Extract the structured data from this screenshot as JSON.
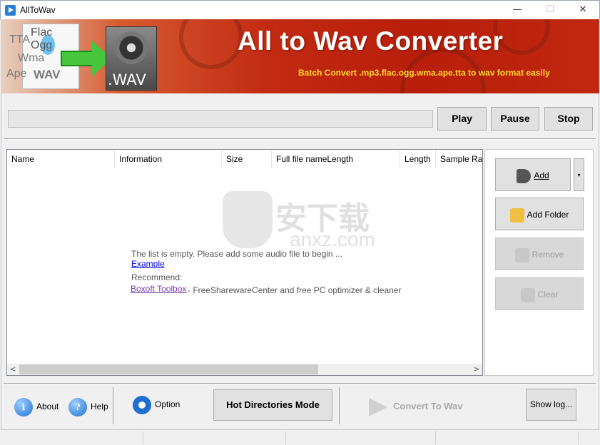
{
  "window": {
    "title": "AllToWav",
    "minimize_glyph": "—",
    "maximize_glyph": "☐",
    "close_glyph": "✕"
  },
  "banner": {
    "title": "All to Wav Converter",
    "subtitle": "Batch Convert .mp3.flac.ogg.wma.ape.tta to wav format easily",
    "formats": [
      "Flac",
      "Ogg",
      "TTA",
      "Wma",
      "Ape",
      "WAV"
    ],
    "wav_label": ".WAV"
  },
  "player": {
    "play_label": "Play",
    "pause_label": "Pause",
    "stop_label": "Stop"
  },
  "file_list": {
    "columns": [
      "Name",
      "Information",
      "Size",
      "Full file nameLength",
      "Length",
      "Sample Rate"
    ],
    "empty_message": "The list is empty. Please add some audio file to begin ...",
    "example_link": "Example",
    "recommend_label": "Recommend:",
    "recommend_link": "Boxoft Toolbox",
    "recommend_text": "- FreeSharewareCenter and free PC optimizer & cleaner",
    "scroll_left": "<",
    "scroll_right": ">"
  },
  "watermark": {
    "text": "安下载",
    "url": "anxz.com"
  },
  "side_panel": {
    "add_label": "Add",
    "add_dropdown": "▾",
    "add_folder_label": "Add Folder",
    "remove_label": "Remove",
    "clear_label": "Clear"
  },
  "toolbar": {
    "about_label": "About",
    "help_label": "Help",
    "option_label": "Option",
    "hot_directories_label": "Hot Directories Mode",
    "convert_label": "Convert To Wav",
    "show_log_label": "Show log..."
  }
}
